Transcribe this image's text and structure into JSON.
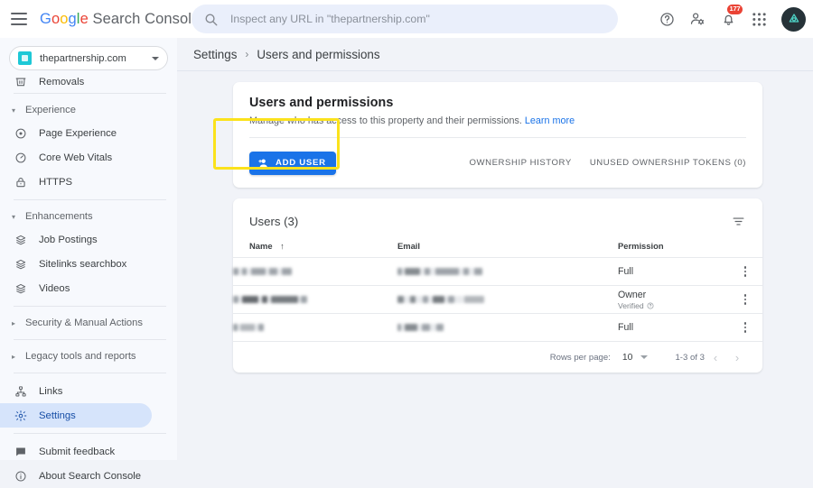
{
  "topbar": {
    "menu_icon": "hamburger-menu-icon",
    "brand": {
      "g": "G",
      "o1": "o",
      "o2": "o",
      "g2": "g",
      "l": "l",
      "e": "e",
      "product": " Search Console"
    },
    "search": {
      "icon": "search-icon",
      "placeholder": "Inspect any URL in \"thepartnership.com\"",
      "value": ""
    },
    "help_icon": "help-circle-icon",
    "account_icon": "account-settings-icon",
    "notifications_icon": "notifications-bell-icon",
    "notifications_badge": "177",
    "apps_icon": "apps-grid-icon",
    "avatar": "user-avatar"
  },
  "sidebar": {
    "property": {
      "icon": "property-icon",
      "name": "thepartnership.com",
      "caret": "chevron-down-icon"
    },
    "clipped_item": {
      "icon": "removals-icon",
      "label": "Removals"
    },
    "groups": [
      {
        "label": "Experience",
        "items": [
          {
            "icon": "page-experience-icon",
            "label": "Page Experience"
          },
          {
            "icon": "core-web-vitals-icon",
            "label": "Core Web Vitals"
          },
          {
            "icon": "https-lock-icon",
            "label": "HTTPS"
          }
        ]
      },
      {
        "label": "Enhancements",
        "items": [
          {
            "icon": "job-postings-icon",
            "label": "Job Postings"
          },
          {
            "icon": "sitelinks-searchbox-icon",
            "label": "Sitelinks searchbox"
          },
          {
            "icon": "videos-icon",
            "label": "Videos"
          }
        ]
      }
    ],
    "collapsed_groups": [
      {
        "label": "Security & Manual Actions"
      },
      {
        "label": "Legacy tools and reports"
      }
    ],
    "bottom_items": [
      {
        "icon": "links-icon",
        "label": "Links",
        "active": false
      },
      {
        "icon": "settings-gear-icon",
        "label": "Settings",
        "active": true
      }
    ],
    "footer_items": [
      {
        "icon": "feedback-icon",
        "label": "Submit feedback"
      },
      {
        "icon": "info-circle-icon",
        "label": "About Search Console"
      }
    ]
  },
  "breadcrumb": {
    "parent": "Settings",
    "separator": "›",
    "current": "Users and permissions"
  },
  "permissions_card": {
    "title": "Users and permissions",
    "description": "Manage who has access to this property and their permissions.",
    "learn_more": "Learn more",
    "add_user_button": "ADD USER",
    "add_user_icon": "person-add-icon",
    "tabs": [
      {
        "label": "OWNERSHIP HISTORY"
      },
      {
        "label": "UNUSED OWNERSHIP TOKENS (0)"
      }
    ],
    "highlight": "add-user-highlight-box"
  },
  "users_card": {
    "title": "Users (3)",
    "filter_icon": "filter-icon",
    "columns": {
      "name": "Name",
      "sort_icon": "↑",
      "email": "Email",
      "permission": "Permission"
    },
    "rows": [
      {
        "name": "[redacted]",
        "email": "[redacted]",
        "permission": "Full",
        "verified": ""
      },
      {
        "name": "[redacted]",
        "email": "[redacted]",
        "permission": "Owner",
        "verified": "Verified"
      },
      {
        "name": "[redacted]",
        "email": "[redacted]",
        "permission": "Full",
        "verified": ""
      }
    ],
    "footer": {
      "rows_per_page_label": "Rows per page:",
      "rows_per_page_value": "10",
      "range": "1-3 of 3",
      "prev_icon": "chevron-left-icon",
      "next_icon": "chevron-right-icon"
    }
  },
  "colors": {
    "accent_blue": "#1a73e8",
    "highlight_yellow": "#fbe21c",
    "badge_red": "#ea4335",
    "page_bg": "#f1f3f8",
    "sidebar_bg": "#f7f9fd",
    "active_nav": "#d6e4fb"
  }
}
